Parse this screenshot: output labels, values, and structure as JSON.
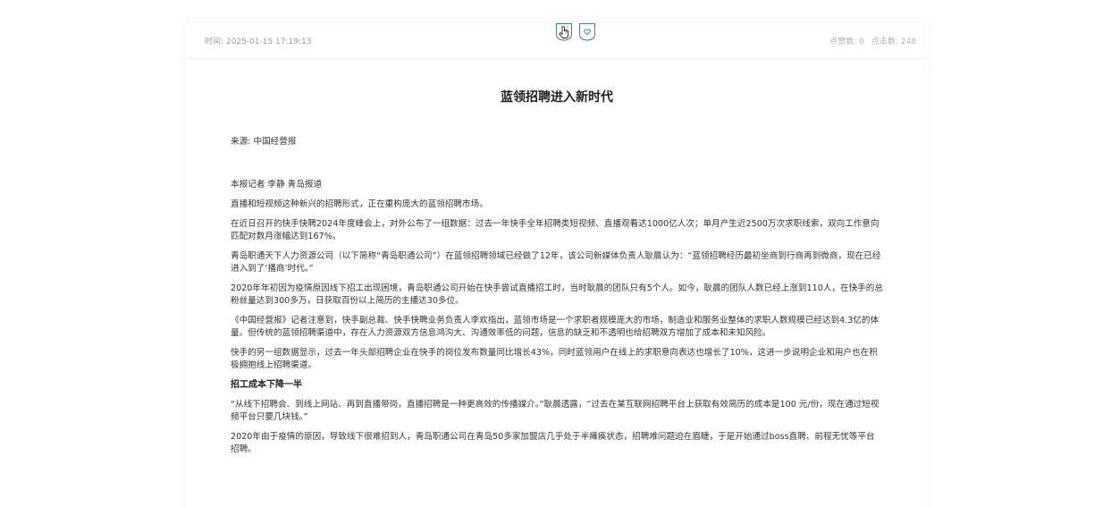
{
  "meta": {
    "time": "时间: 2025-01-15 17:19:13",
    "likes": "点赞数: 0",
    "clicks": "点击数: 248"
  },
  "actions": {
    "like_icon": "hand-pointer-icon",
    "favorite_icon": "heart-icon"
  },
  "article": {
    "title": "蓝领招聘进入新时代",
    "source": "来源: 中国经营报",
    "paragraphs": [
      "本报记者 李静 青岛报道",
      "直播和短视频这种新兴的招聘形式，正在重构庞大的蓝领招聘市场。",
      "在近日召开的快手快聘2024年度峰会上，对外公布了一组数据：过去一年快手全年招聘类短视频、直播观看达1000亿人次；单月产生近2500万次求职线索，双向工作意向匹配对数月涨幅达到167%。",
      "青岛职通天下人力资源公司（以下简称“青岛职通公司”）在蓝领招聘领域已经做了12年，该公司新媒体负责人耿晨认为：“蓝领招聘经历最初坐商到行商再到微商，现在已经进入到了‘播商’时代。”",
      "2020年年初因为疫情原因线下招工出现困境，青岛职通公司开始在快手尝试直播招工时，当时耿晨的团队只有5个人。如今，耿晨的团队人数已经上涨到110人，在快手的总粉丝量达到300多万，日获取百份以上简历的主播达30多位。",
      "《中国经营报》记者注意到，快手副总裁、快手快聘业务负责人李欢指出，蓝领市场是一个求职者规模庞大的市场，制造业和服务业整体的求职人数规模已经达到4.3亿的体量。但传统的蓝领招聘渠道中，存在人力资源双方信息鸿沟大、沟通效率低的问题，信息的缺乏和不透明也给招聘双方增加了成本和未知风险。",
      "快手的另一组数据显示，过去一年头部招聘企业在快手的岗位发布数量同比增长43%，同时蓝领用户在线上的求职意向表达也增长了10%，这进一步说明企业和用户也在积极拥抱线上招聘渠道。"
    ],
    "subheading": "招工成本下降一半",
    "paragraphs2": [
      "“从线下招聘会、到线上网站、再到直播带岗，直播招聘是一种更高效的传播媒介。”耿晨透露，“过去在某互联网招聘平台上获取有效简历的成本是100 元/份，现在通过短视频平台只要几块钱。”",
      "2020年由于疫情的原因，导致线下很难招到人，青岛职通公司在青岛50多家加盟店几乎处于半瘫痪状态，招聘难问题迫在眉睫，于是开始通过boss直聘、前程无忧等平台招聘。"
    ]
  }
}
